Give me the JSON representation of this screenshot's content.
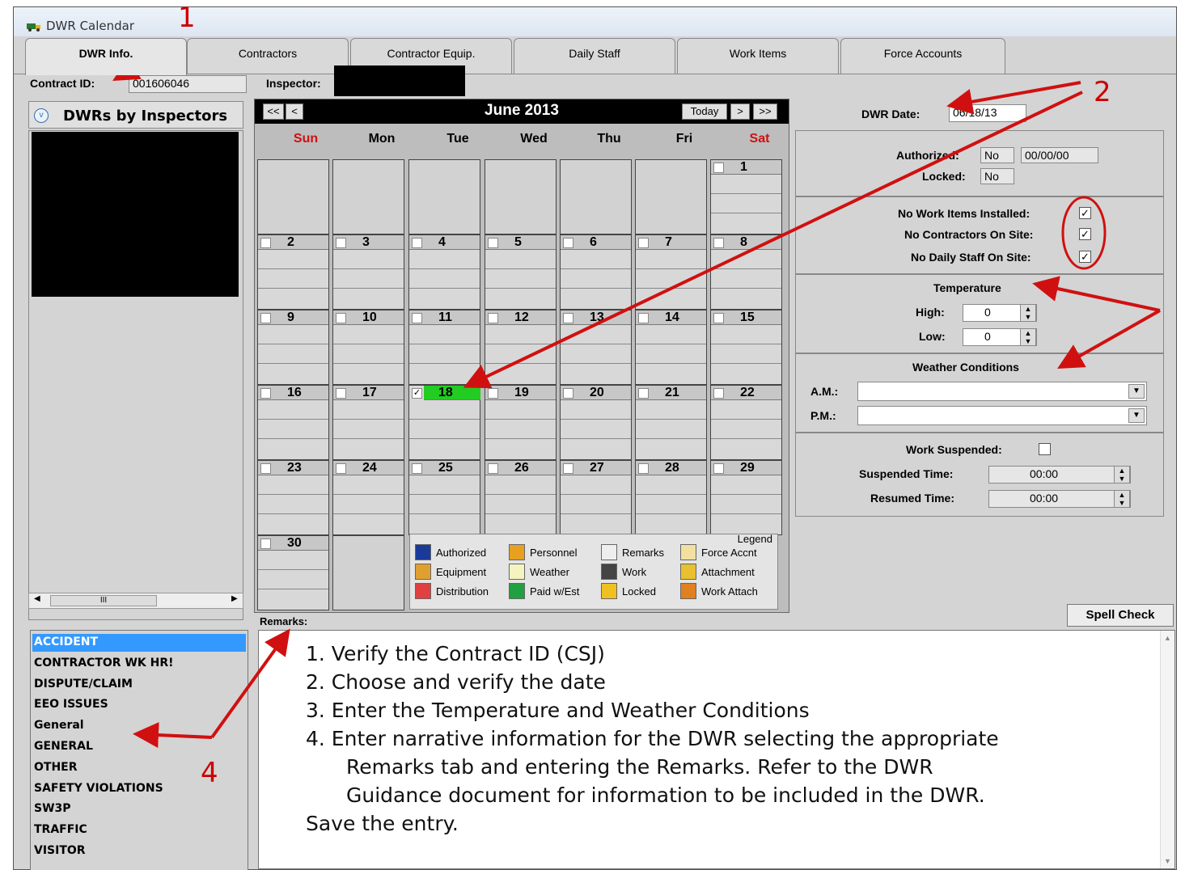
{
  "window": {
    "title": "DWR Calendar"
  },
  "tabs": [
    "DWR Info.",
    "Contractors",
    "Contractor Equip.",
    "Daily Staff",
    "Work Items",
    "Force Accounts"
  ],
  "contract": {
    "label": "Contract ID:",
    "value": "001606046",
    "inspector_label": "Inspector:"
  },
  "inspectors_panel": {
    "title": "DWRs by Inspectors",
    "scroll_text": "III"
  },
  "calendar": {
    "nav_prev2": "<<",
    "nav_prev": "<",
    "month": "June 2013",
    "today": "Today",
    "nav_next": ">",
    "nav_next2": ">>",
    "days": [
      "Sun",
      "Mon",
      "Tue",
      "Wed",
      "Thu",
      "Fri",
      "Sat"
    ],
    "selected_day": "18"
  },
  "legend": {
    "title": "Legend",
    "items": [
      "Authorized",
      "Personnel",
      "Remarks",
      "Force Accnt",
      "Equipment",
      "Weather",
      "Work",
      "Attachment",
      "Distribution",
      "Paid w/Est",
      "Locked",
      "Work Attach"
    ]
  },
  "right_panel": {
    "dwr_date_label": "DWR Date:",
    "dwr_date": "06/18/13",
    "authorized_label": "Authorized:",
    "authorized": "No",
    "authorized_date": "00/00/00",
    "locked_label": "Locked:",
    "locked": "No",
    "no_work_items": "No Work Items Installed:",
    "no_contractors": "No Contractors On Site:",
    "no_staff": "No Daily Staff On Site:",
    "temperature": "Temperature",
    "high_label": "High:",
    "high": "0",
    "low_label": "Low:",
    "low": "0",
    "weather": "Weather Conditions",
    "am": "A.M.:",
    "pm": "P.M.:",
    "work_suspended": "Work Suspended:",
    "suspended_time_label": "Suspended Time:",
    "suspended_time": "00:00",
    "resumed_time_label": "Resumed Time:",
    "resumed_time": "00:00"
  },
  "remarks": {
    "label": "Remarks:",
    "spell_check": "Spell Check",
    "categories": [
      "ACCIDENT",
      "CONTRACTOR WK HR!",
      "DISPUTE/CLAIM",
      "EEO ISSUES",
      "General",
      "GENERAL",
      "OTHER",
      "SAFETY VIOLATIONS",
      "SW3P",
      "TRAFFIC",
      "VISITOR"
    ],
    "instructions": [
      "1.  Verify the Contract ID (CSJ)",
      "2.  Choose and verify the date",
      "3.  Enter the Temperature and Weather Conditions",
      "4.  Enter narrative information for the DWR selecting the appropriate",
      "Remarks tab and entering the Remarks.  Refer to the DWR",
      "Guidance document for information to be included in the DWR.",
      "Save the entry."
    ]
  },
  "annotations": [
    "1",
    "2",
    "4"
  ],
  "colors": {
    "accent_red": "#d01010",
    "selected_green": "#22cc22",
    "list_highlight": "#3399ff"
  }
}
